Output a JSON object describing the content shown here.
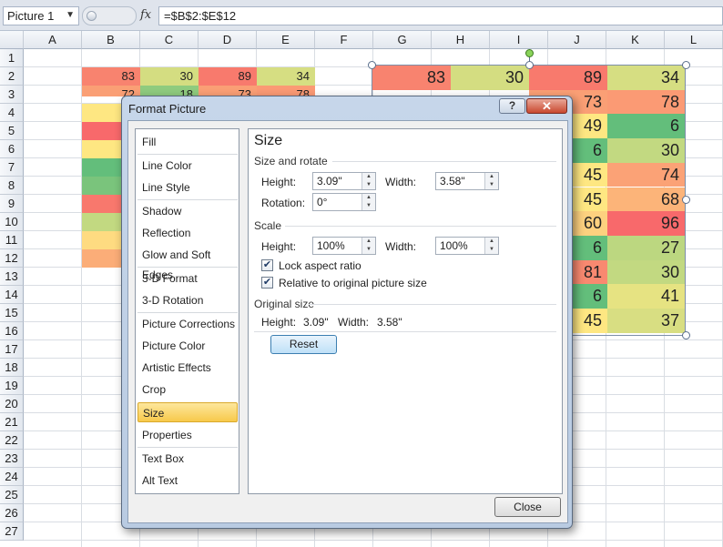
{
  "formula_bar": {
    "name_box": "Picture 1",
    "fx_label": "fx",
    "formula": "=$B$2:$E$12"
  },
  "columns": [
    "A",
    "B",
    "C",
    "D",
    "E",
    "F",
    "G",
    "H",
    "I",
    "J",
    "K",
    "L"
  ],
  "rows": [
    "1",
    "2",
    "3",
    "4",
    "5",
    "6",
    "7",
    "8",
    "9",
    "10",
    "11",
    "12",
    "13",
    "14",
    "15",
    "16",
    "17",
    "18",
    "19",
    "20",
    "21",
    "22",
    "23",
    "24",
    "25",
    "26",
    "27"
  ],
  "sheet_row2": [
    "83",
    "30",
    "89",
    "34"
  ],
  "sheet_row3": [
    "72",
    "18",
    "73",
    "78"
  ],
  "picture_values": [
    [
      "83",
      "30",
      "89",
      "34"
    ],
    [
      "",
      "",
      "73",
      "78"
    ],
    [
      "",
      "",
      "49",
      "6"
    ],
    [
      "",
      "",
      "6",
      "30"
    ],
    [
      "",
      "",
      "45",
      "74"
    ],
    [
      "",
      "",
      "45",
      "68"
    ],
    [
      "",
      "",
      "60",
      "96"
    ],
    [
      "",
      "",
      "6",
      "27"
    ],
    [
      "",
      "",
      "81",
      "30"
    ],
    [
      "",
      "",
      "6",
      "41"
    ],
    [
      "",
      "",
      "45",
      "37"
    ]
  ],
  "dialog": {
    "title": "Format Picture",
    "help": "?",
    "close_x": "✕",
    "categories": [
      "Fill",
      "Line Color",
      "Line Style",
      "Shadow",
      "Reflection",
      "Glow and Soft Edges",
      "3-D Format",
      "3-D Rotation",
      "Picture Corrections",
      "Picture Color",
      "Artistic Effects",
      "Crop",
      "Size",
      "Properties",
      "Text Box",
      "Alt Text"
    ],
    "selected_category": "Size",
    "panel": {
      "title": "Size",
      "size_rotate_label": "Size and rotate",
      "height_label": "Height:",
      "height_value": "3.09\"",
      "width_label": "Width:",
      "width_value": "3.58\"",
      "rotation_label": "Rotation:",
      "rotation_value": "0°",
      "scale_label": "Scale",
      "scale_height_label": "Height:",
      "scale_height_value": "100%",
      "scale_width_label": "Width:",
      "scale_width_value": "100%",
      "lock_aspect": "Lock aspect ratio",
      "relative_size": "Relative to original picture size",
      "original_size_label": "Original size",
      "orig_height_label": "Height:",
      "orig_height_value": "3.09\"",
      "orig_width_label": "Width:",
      "orig_width_value": "3.58\"",
      "reset": "Reset"
    },
    "close_button": "Close"
  },
  "colors": {
    "red": "#f8696b",
    "orange": "#fa9473",
    "yellow": "#ffe883",
    "lightgreen": "#c3d980",
    "green": "#63be7b"
  }
}
